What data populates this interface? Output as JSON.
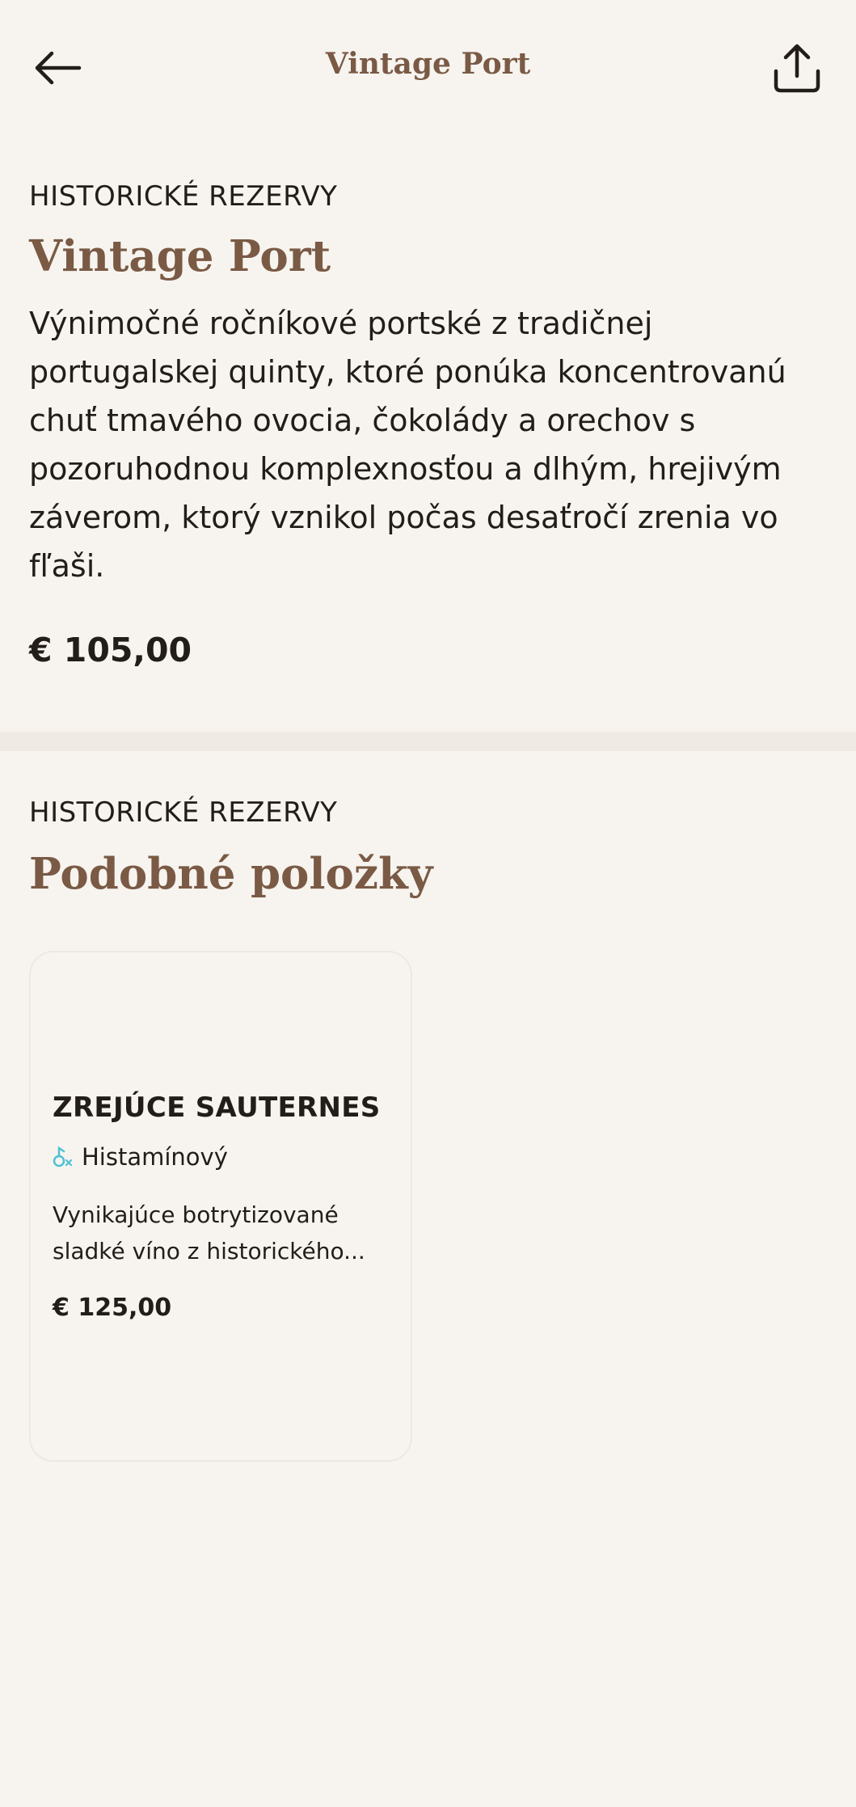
{
  "header": {
    "title": "Vintage Port",
    "back_icon": "arrow-left-icon",
    "share_icon": "share-upload-icon"
  },
  "product": {
    "category": "HISTORICKÉ REZERVY",
    "name": "Vintage Port",
    "description": "Výnimočné ročníkové portské z tradičnej portugalskej quinty, ktoré ponúka koncentrovanú chuť tmavého ovocia, čokolády a orechov s pozoruhodnou komplexnosťou a dlhým, hrejivým záverom, ktorý vznikol počas desaťročí zrenia vo fľaši.",
    "price": "€ 105,00"
  },
  "similar": {
    "category": "HISTORICKÉ REZERVY",
    "heading": "Podobné položky",
    "items": [
      {
        "name": "ZREJÚCE SAUTERNES",
        "tag_icon": "histamine-icon",
        "tag": "Histamínový",
        "description": "Vynikajúce botrytizované sladké víno z historického...",
        "price": "€ 125,00"
      }
    ]
  },
  "colors": {
    "background": "#f7f4ef",
    "accent_brown": "#7a5a45",
    "text": "#221d18",
    "tag_icon": "#4fc1d6"
  }
}
